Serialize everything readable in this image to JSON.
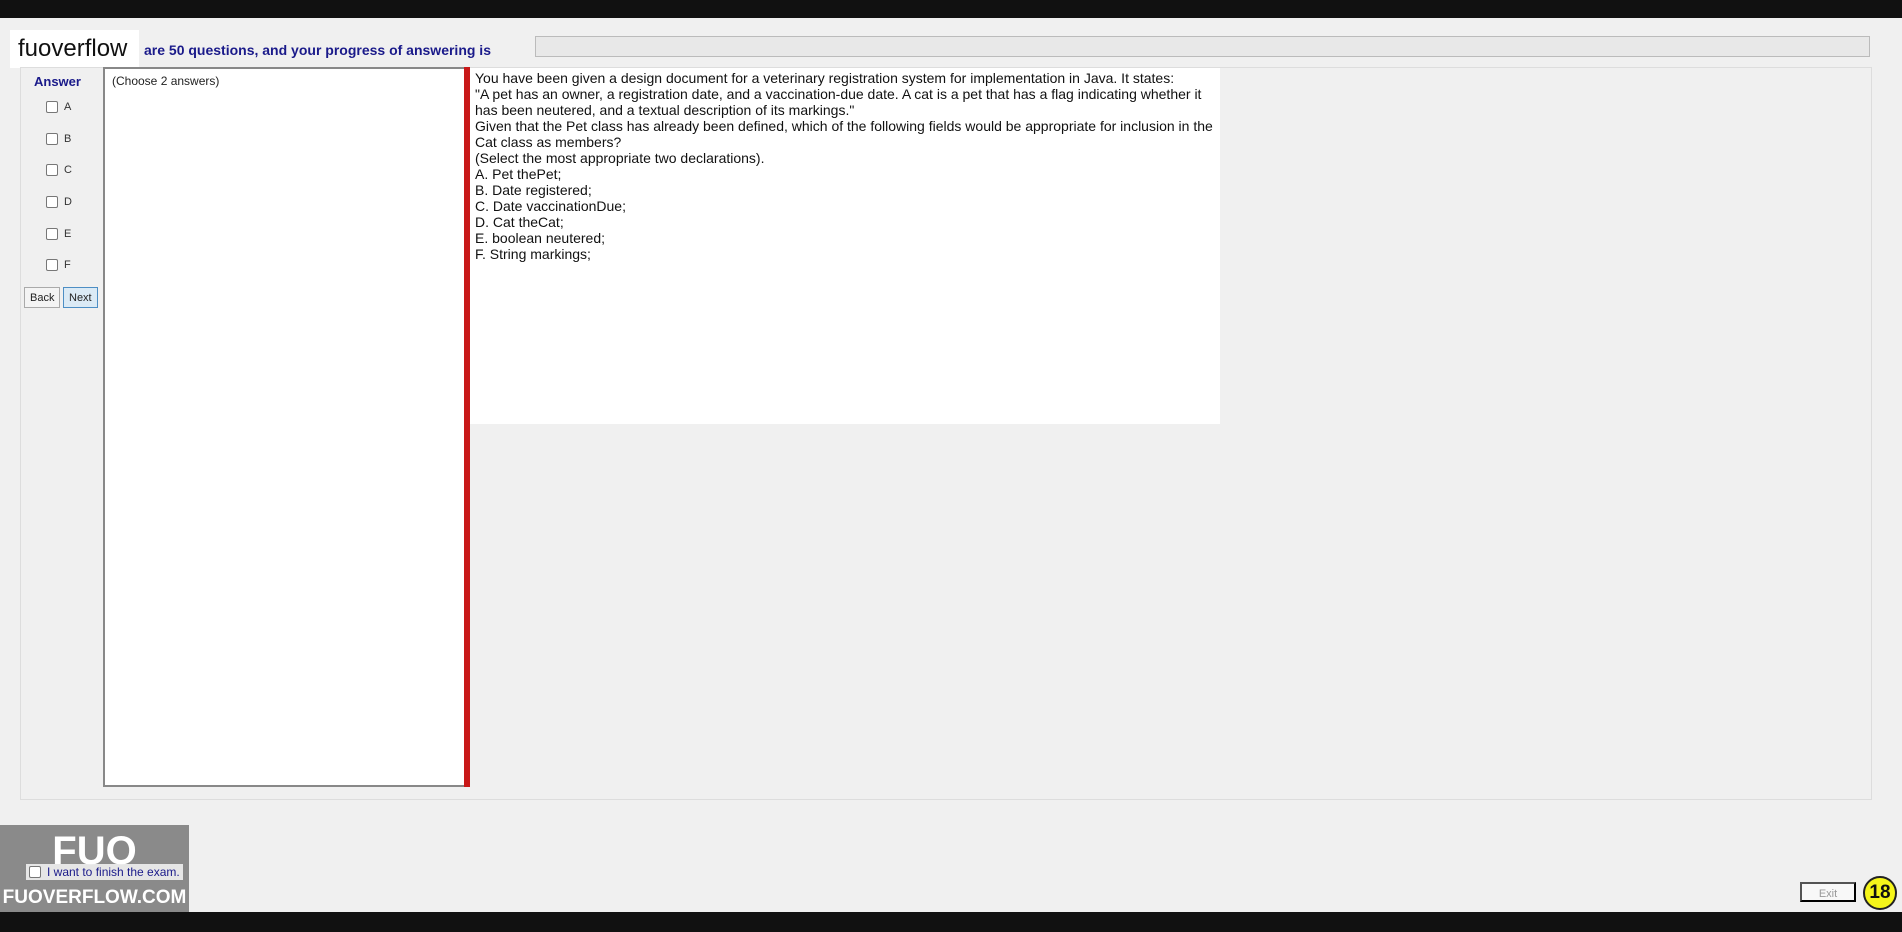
{
  "brand": "fuoverflow",
  "header": {
    "progress_text": "are 50 questions, and your progress of answering is",
    "progress": 0
  },
  "answer_panel": {
    "title": "Answer",
    "options": [
      "A",
      "B",
      "C",
      "D",
      "E",
      "F"
    ],
    "back": "Back",
    "next": "Next"
  },
  "left_frame": {
    "instruction": "(Choose 2 answers)"
  },
  "question": {
    "lines": [
      "You have been given a design document for a veterinary registration system for implementation in Java. It states:",
      "\"A pet has an owner, a registration date, and a vaccination-due date. A cat is a pet that has a flag indicating whether it has been neutered, and a textual description of its markings.\"",
      "Given that the Pet class has already been defined, which of the following fields would be appropriate for inclusion in the Cat class as members?",
      "(Select the most appropriate two declarations)."
    ],
    "options": [
      "A.  Pet thePet;",
      "B.  Date registered;",
      "C.  Date vaccinationDue;",
      "D.  Cat theCat;",
      "E.  boolean neutered;",
      "F.  String markings;"
    ]
  },
  "footer": {
    "finish_label": "I want to finish the exam.",
    "exit": "Exit",
    "badge": "18"
  },
  "logo": {
    "mark": "FUO",
    "text": "FUOVERFLOW.COM"
  }
}
